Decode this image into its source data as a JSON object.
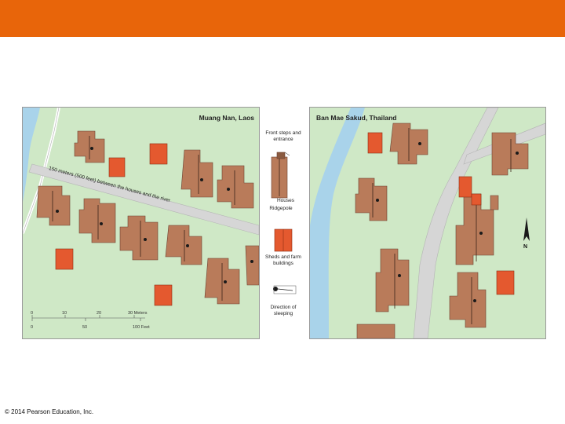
{
  "maps": {
    "left_title": "Muang Nan, Laos",
    "right_title": "Ban Mae Sakud, Thailand",
    "road_label": "150 meters (500 feet) between the houses and the river",
    "north_label": "N"
  },
  "legend": {
    "front_steps": "Front steps and entrance",
    "houses": "Houses",
    "ridgepole": "Ridgepole",
    "sheds": "Sheds and farm buildings",
    "direction": "Direction of sleeping"
  },
  "scale": {
    "meters_ticks": [
      "0",
      "10",
      "20",
      "30 Meters"
    ],
    "feet_ticks": [
      "0",
      "50",
      "100 Feet"
    ]
  },
  "colors": {
    "banner": "#e8650a",
    "land": "#cfe8c6",
    "river": "#a9d3ea",
    "road": "#d6d6d6",
    "house": "#b97b5a",
    "shed": "#e4592f"
  },
  "footer": {
    "copyright": "© 2014 Pearson Education, Inc."
  }
}
